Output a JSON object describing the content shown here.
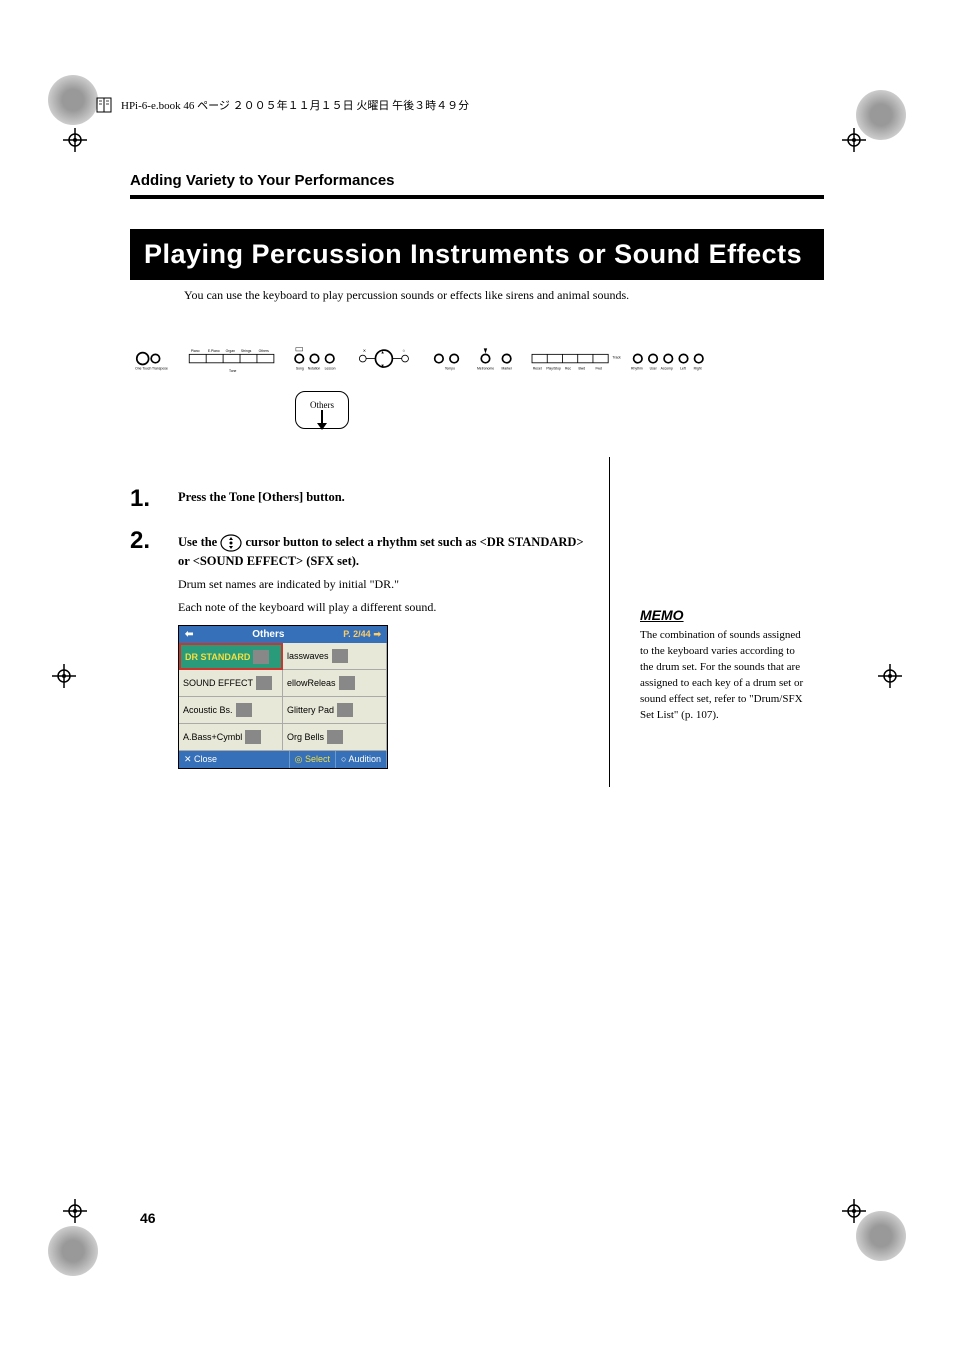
{
  "header_bar": {
    "text": "HPi-6-e.book 46 ページ ２００５年１１月１５日 火曜日 午後３時４９分"
  },
  "section_title": "Adding Variety to Your Performances",
  "main_heading": "Playing Percussion Instruments or Sound Effects",
  "intro_text": "You can use the keyboard to play percussion sounds or effects like sirens and animal sounds.",
  "others_callout": "Others",
  "steps": [
    {
      "num": "1.",
      "text": "Press the Tone [Others] button."
    },
    {
      "num": "2.",
      "text_before": "Use the ",
      "text_after": " cursor button to select a rhythm set such as <DR STANDARD> or <SOUND EFFECT> (SFX set).",
      "note1": "Drum set names are indicated by initial \"DR.\"",
      "note2": "Each note of the keyboard will play a different sound."
    }
  ],
  "lcd": {
    "header_arrow_left": "⬅",
    "header_title": "Others",
    "header_page": "P. 2/44",
    "header_arrow_right": "➡",
    "cells": [
      {
        "label": "DR STANDARD",
        "selected": true
      },
      {
        "label": "lasswaves",
        "selected": false
      },
      {
        "label": "SOUND EFFECT",
        "selected": false
      },
      {
        "label": "ellowReleas",
        "selected": false
      },
      {
        "label": "Acoustic Bs.",
        "selected": false
      },
      {
        "label": "Glittery Pad",
        "selected": false
      },
      {
        "label": "A.Bass+Cymbl",
        "selected": false
      },
      {
        "label": "Org Bells",
        "selected": false
      }
    ],
    "footer": {
      "close": "✕ Close",
      "select": "◎ Select",
      "audition": "○ Audition"
    }
  },
  "memo": {
    "label": "MEMO",
    "text": "The combination of sounds assigned to the keyboard varies according to the drum set. For the sounds that are assigned to each key of a drum set or sound effect set, refer to \"Drum/SFX Set List\" (p. 107)."
  },
  "page_number": "46"
}
